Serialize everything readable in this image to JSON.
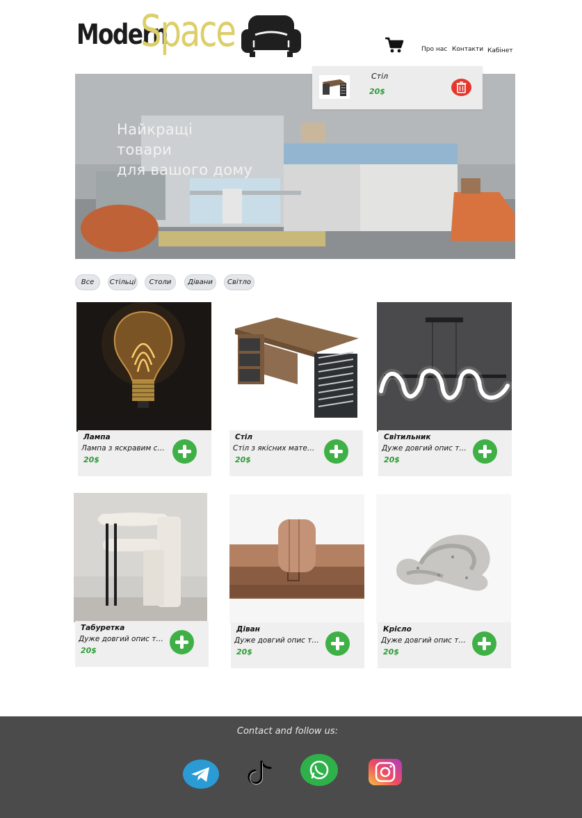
{
  "header": {
    "logo_word_1": "Modern",
    "logo_word_2": "Space",
    "nav": [
      "Про нас",
      "Контакти",
      "Кабінет"
    ]
  },
  "hero": {
    "headline": [
      "Найкращі",
      "товари",
      "для вашого дому"
    ]
  },
  "cart_popup": {
    "item_name": "Стіл",
    "item_price": "20$"
  },
  "filters": [
    "Все",
    "Стільці",
    "Столи",
    "Дівани",
    "Світло"
  ],
  "products": [
    {
      "name": "Лампа",
      "description": "Лампа з яскравим світлом",
      "price": "20$"
    },
    {
      "name": "Стіл",
      "description": "Стіл з якісних матеріалів",
      "price": "20$"
    },
    {
      "name": "Світильник",
      "description": "Дуже довгий опис товару",
      "price": "20$"
    },
    {
      "name": "Табуретка",
      "description": "Дуже довгий опис товару",
      "price": "20$"
    },
    {
      "name": "Діван",
      "description": "Дуже довгий опис товару",
      "price": "20$"
    },
    {
      "name": "Крісло",
      "description": "Дуже довгий опис товару",
      "price": "20$"
    }
  ],
  "footer": {
    "title": "Contact and follow us:",
    "socials": [
      "telegram-icon",
      "tiktok-icon",
      "whatsapp-icon",
      "instagram-icon"
    ]
  },
  "colors": {
    "accent_green": "#3fb045",
    "price_green": "#2e9c36",
    "logo_yellow": "#dccf69",
    "footer_bg": "#4b4b4b",
    "delete_red": "#e3372c"
  }
}
